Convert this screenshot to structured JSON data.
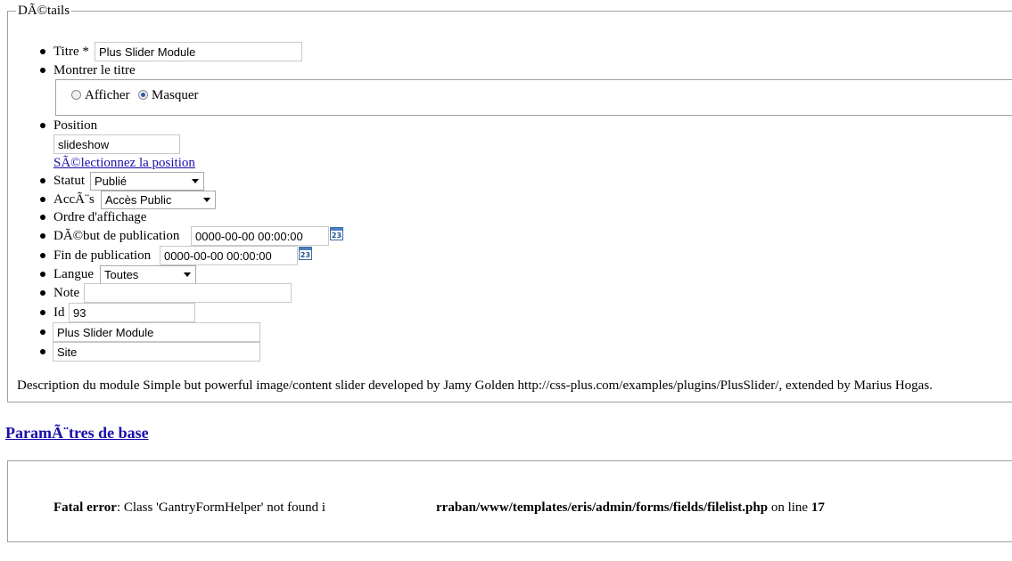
{
  "fieldset": {
    "legend": "DÃ©tails"
  },
  "fields": {
    "titre": {
      "label": "Titre *",
      "value": "Plus Slider Module"
    },
    "montrer_titre": {
      "label": "Montrer le titre",
      "options": [
        {
          "label": "Afficher",
          "checked": false
        },
        {
          "label": "Masquer",
          "checked": true
        }
      ]
    },
    "position": {
      "label": "Position",
      "value": "slideshow",
      "link": "SÃ©lectionnez la position"
    },
    "statut": {
      "label": "Statut",
      "selected": "Publié"
    },
    "acces": {
      "label": "AccÃ¨s",
      "selected": "Accès Public"
    },
    "ordre": {
      "label": "Ordre d'affichage"
    },
    "debut": {
      "label": "DÃ©but de publication",
      "value": "0000-00-00 00:00:00",
      "calendar_icon": "23"
    },
    "fin": {
      "label": "Fin de publication",
      "value": "0000-00-00 00:00:00",
      "calendar_icon": "23"
    },
    "langue": {
      "label": "Langue",
      "selected": "Toutes"
    },
    "note": {
      "label": "Note",
      "value": ""
    },
    "id": {
      "label": "Id",
      "value": "93"
    },
    "module": {
      "value": "Plus Slider Module"
    },
    "client": {
      "value": "Site"
    }
  },
  "description": "Description du module Simple but powerful image/content slider developed by Jamy Golden http://css-plus.com/examples/plugins/PlusSlider/, extended by Marius Hogas.",
  "params_heading": "ParamÃ¨tres de base",
  "error": {
    "label": "Fatal error",
    "message": ": Class 'GantryFormHelper' not found i",
    "path": "rraban/www/templates/eris/admin/forms/fields/filelist.php",
    "on_line": "on line",
    "line": "17"
  }
}
